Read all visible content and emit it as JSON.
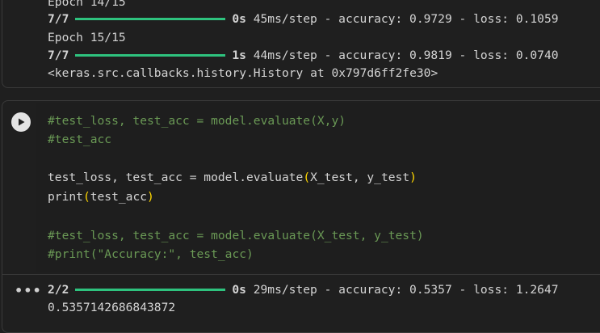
{
  "previous_output": {
    "epoch14_label": "Epoch 14/15",
    "epoch14_steps": "7/7",
    "epoch14_time": "0s",
    "epoch14_metrics": "45ms/step - accuracy: 0.9729 - loss: 0.1059",
    "epoch15_label": "Epoch 15/15",
    "epoch15_steps": "7/7",
    "epoch15_time": "1s",
    "epoch15_metrics": "44ms/step - accuracy: 0.9819 - loss: 0.0740",
    "history_repr": "<keras.src.callbacks.history.History at 0x797d6ff2fe30>"
  },
  "code_cell": {
    "line1": "#test_loss, test_acc = model.evaluate(X,y)",
    "line2": "#test_acc",
    "line4_a": "test_loss, test_acc = model.evaluate",
    "line4_paren_open": "(",
    "line4_args": "X_test, y_test",
    "line4_paren_close": ")",
    "line5_a": "print",
    "line5_paren_open": "(",
    "line5_args": "test_acc",
    "line5_paren_close": ")",
    "line7": "#test_loss, test_acc = model.evaluate(X_test, y_test)",
    "line8": "#print(\"Accuracy:\", test_acc)"
  },
  "cell_output": {
    "steps": "2/2",
    "time": "0s",
    "metrics": "29ms/step - accuracy: 0.5357 - loss: 1.2647",
    "printed_value": "0.5357142686843872"
  },
  "icons": {
    "run": "play-icon",
    "output_menu": "more-horiz-icon"
  },
  "colors": {
    "progress_bar": "#2ec27e",
    "comment": "#6a9955",
    "paren": "#ffd700"
  }
}
